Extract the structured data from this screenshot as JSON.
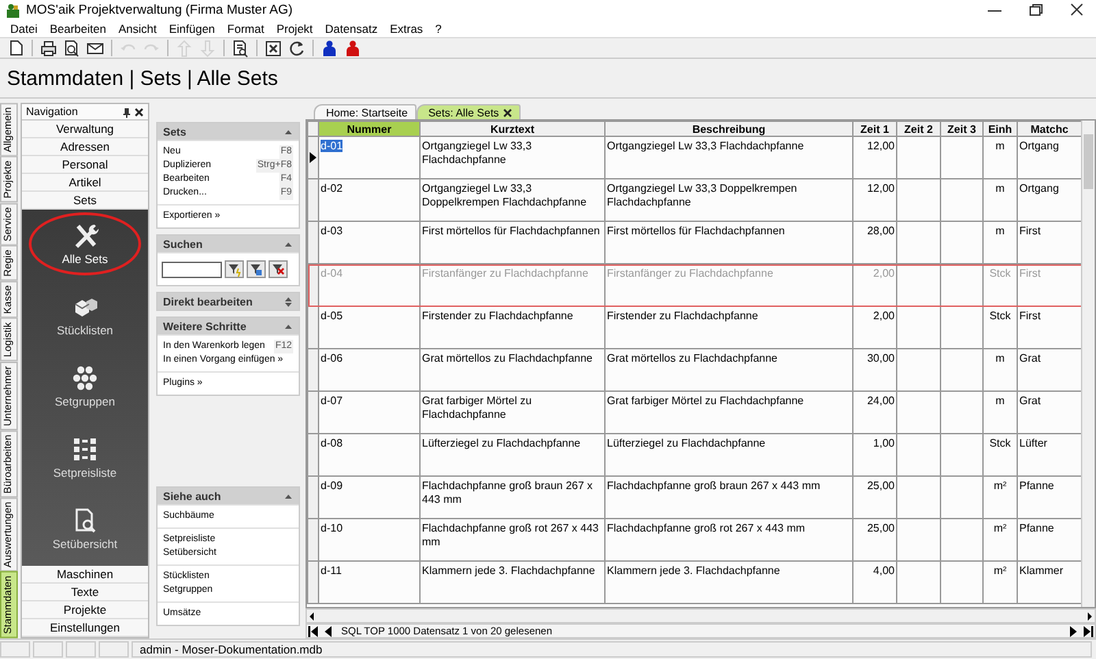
{
  "window": {
    "title": "MOS'aik Projektverwaltung (Firma Muster AG)"
  },
  "menu": [
    "Datei",
    "Bearbeiten",
    "Ansicht",
    "Einfügen",
    "Format",
    "Projekt",
    "Datensatz",
    "Extras",
    "?"
  ],
  "toolbar": [
    [
      {
        "kind": "new",
        "disabled": false
      }
    ],
    [
      {
        "kind": "print",
        "disabled": false
      },
      {
        "kind": "preview",
        "disabled": false
      },
      {
        "kind": "mail",
        "disabled": false
      }
    ],
    [
      {
        "kind": "undo",
        "disabled": true
      },
      {
        "kind": "redo",
        "disabled": true
      }
    ],
    [
      {
        "kind": "up",
        "disabled": true
      },
      {
        "kind": "down",
        "disabled": true
      }
    ],
    [
      {
        "kind": "docsearch",
        "disabled": false
      }
    ],
    [
      {
        "kind": "xbox",
        "disabled": false
      },
      {
        "kind": "refresh",
        "disabled": false
      }
    ],
    [
      {
        "kind": "user-blue",
        "disabled": false
      },
      {
        "kind": "user-red",
        "disabled": false
      }
    ]
  ],
  "breadcrumb": "Stammdaten | Sets | Alle Sets",
  "side_tabs": [
    {
      "label": "Allgemein",
      "selected": false
    },
    {
      "label": "Projekte",
      "selected": false
    },
    {
      "label": "Service",
      "selected": false
    },
    {
      "label": "Regie",
      "selected": false
    },
    {
      "label": "Kasse",
      "selected": false
    },
    {
      "label": "Logistik",
      "selected": false
    },
    {
      "label": "Unternehmer",
      "selected": false
    },
    {
      "label": "Büroarbeiten",
      "selected": false
    },
    {
      "label": "Auswertungen",
      "selected": false
    },
    {
      "label": "Stammdaten",
      "selected": true
    }
  ],
  "navigation": {
    "title": "Navigation",
    "top_items": [
      {
        "label": "Verwaltung"
      },
      {
        "label": "Adressen"
      },
      {
        "label": "Personal"
      },
      {
        "label": "Artikel"
      },
      {
        "label": "Sets"
      }
    ],
    "views": [
      {
        "label": "Alle Sets",
        "kind": "tools",
        "selected": true
      },
      {
        "label": "Stücklisten",
        "kind": "cubes",
        "selected": false
      },
      {
        "label": "Setgruppen",
        "kind": "dots",
        "selected": false
      },
      {
        "label": "Setpreisliste",
        "kind": "grid",
        "selected": false
      },
      {
        "label": "Setübersicht",
        "kind": "docsearch",
        "selected": false
      }
    ],
    "bottom_items": [
      {
        "label": "Maschinen"
      },
      {
        "label": "Texte"
      },
      {
        "label": "Projekte"
      },
      {
        "label": "Einstellungen"
      }
    ]
  },
  "task_panel": {
    "sections": [
      {
        "title": "Sets",
        "kind": "links",
        "expanded": true,
        "groups": [
          [
            {
              "label": "Neu",
              "shortcut": "F8"
            },
            {
              "label": "Duplizieren",
              "shortcut": "Strg+F8"
            },
            {
              "label": "Bearbeiten",
              "shortcut": "F4"
            },
            {
              "label": "Drucken...",
              "shortcut": "F9"
            }
          ],
          [
            {
              "label": "Exportieren »"
            }
          ]
        ]
      },
      {
        "title": "Suchen",
        "kind": "search",
        "expanded": true
      },
      {
        "title": "Direkt bearbeiten",
        "expanded": false
      },
      {
        "title": "Weitere Schritte",
        "kind": "links",
        "expanded": true,
        "groups": [
          [
            {
              "label": "In den Warenkorb legen",
              "shortcut": "F12"
            },
            {
              "label": "In einen Vorgang einfügen »"
            }
          ],
          [
            {
              "label": "Plugins »"
            }
          ]
        ]
      }
    ],
    "bottom_sections": [
      {
        "title": "Siehe auch",
        "kind": "links",
        "expanded": true,
        "groups": [
          [
            {
              "label": "Suchbäume"
            }
          ],
          [
            {
              "label": "Setpreisliste"
            },
            {
              "label": "Setübersicht"
            }
          ],
          [
            {
              "label": "Stücklisten"
            },
            {
              "label": "Setgruppen"
            }
          ],
          [
            {
              "label": "Umsätze"
            }
          ]
        ]
      }
    ]
  },
  "doc_tabs": [
    {
      "label": "Home: Startseite",
      "selected": false
    },
    {
      "label": "Sets: Alle Sets",
      "selected": true
    }
  ],
  "table": {
    "columns": [
      {
        "label": "Nummer",
        "sorted": true
      },
      {
        "label": "Kurztext",
        "sorted": false
      },
      {
        "label": "Beschreibung",
        "sorted": false
      },
      {
        "label": "Zeit 1",
        "sorted": false
      },
      {
        "label": "Zeit 2",
        "sorted": false
      },
      {
        "label": "Zeit 3",
        "sorted": false
      },
      {
        "label": "Einh",
        "sorted": false
      },
      {
        "label": "Matchc",
        "sorted": false
      }
    ],
    "rows": [
      {
        "selected": true,
        "inactive": false,
        "cells": [
          "d-01",
          "Ortgangziegel Lw 33,3 Flachdachpfanne",
          "Ortgangziegel Lw 33,3 Flachdachpfanne",
          "12,00",
          "",
          "",
          "m",
          "Ortgang"
        ]
      },
      {
        "selected": false,
        "inactive": false,
        "cells": [
          "d-02",
          "Ortgangziegel Lw 33,3 Doppelkrempen Flachdachpfanne",
          "Ortgangziegel  Lw 33,3 Doppelkrempen Flachdachpfanne",
          "12,00",
          "",
          "",
          "m",
          "Ortgang"
        ]
      },
      {
        "selected": false,
        "inactive": false,
        "cells": [
          "d-03",
          "First mörtellos für Flachdachpfannen",
          "First mörtellos für Flachdachpfannen",
          "28,00",
          "",
          "",
          "m",
          "First"
        ]
      },
      {
        "selected": false,
        "inactive": true,
        "cells": [
          "d-04",
          "Firstanfänger zu Flachdachpfanne",
          "Firstanfänger zu Flachdachpfanne",
          "2,00",
          "",
          "",
          "Stck",
          "First"
        ]
      },
      {
        "selected": false,
        "inactive": false,
        "cells": [
          "d-05",
          "Firstender zu Flachdachpfanne",
          "Firstender zu Flachdachpfanne",
          "2,00",
          "",
          "",
          "Stck",
          "First"
        ]
      },
      {
        "selected": false,
        "inactive": false,
        "cells": [
          "d-06",
          "Grat mörtellos zu Flachdachpfanne",
          "Grat mörtellos zu Flachdachpfanne",
          "30,00",
          "",
          "",
          "m",
          "Grat"
        ]
      },
      {
        "selected": false,
        "inactive": false,
        "cells": [
          "d-07",
          "Grat farbiger Mörtel zu Flachdachpfanne",
          "Grat farbiger Mörtel zu Flachdachpfanne",
          "24,00",
          "",
          "",
          "m",
          "Grat"
        ]
      },
      {
        "selected": false,
        "inactive": false,
        "cells": [
          "d-08",
          "Lüfterziegel zu Flachdachpfanne",
          "Lüfterziegel zu Flachdachpfanne",
          "1,00",
          "",
          "",
          "Stck",
          "Lüfter"
        ]
      },
      {
        "selected": false,
        "inactive": false,
        "cells": [
          "d-09",
          "Flachdachpfanne groß braun 267 x 443 mm",
          "Flachdachpfanne groß braun 267 x 443 mm",
          "25,00",
          "",
          "",
          "m²",
          "Pfanne"
        ]
      },
      {
        "selected": false,
        "inactive": false,
        "cells": [
          "d-10",
          "Flachdachpfanne groß rot 267 x 443 mm",
          "Flachdachpfanne groß rot 267 x 443 mm",
          "25,00",
          "",
          "",
          "m²",
          "Pfanne"
        ]
      },
      {
        "selected": false,
        "inactive": false,
        "cells": [
          "d-11",
          "Klammern jede 3. Flachdachpfanne",
          "Klammern jede 3. Flachdachpfanne",
          "4,00",
          "",
          "",
          "m²",
          "Klammer"
        ]
      }
    ],
    "record_status": "SQL TOP 1000 Datensatz 1 von 20 gelesenen"
  },
  "status_bar": "admin - Moser-Dokumentation.mdb"
}
